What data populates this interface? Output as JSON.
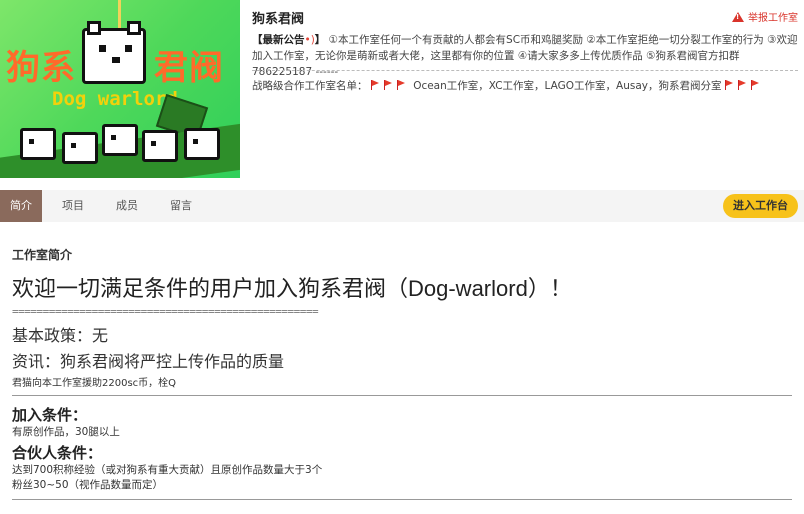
{
  "banner": {
    "cn_left": "狗系",
    "cn_right": "君阀",
    "en_title": "Dog warlord"
  },
  "studio": {
    "name": "狗系君阀",
    "report_label": "举报工作室"
  },
  "announcement": {
    "tag": "【最新公告",
    "tag_end": "】",
    "text": "①本工作室任何一个有贡献的人都会有SC币和鸡腿奖励 ②本工作室拒绝一切分裂工作室的行为 ③欢迎加入工作室，无论你是萌新或者大佬，这里都有你的位置 ④请大家多多上传优质作品 ⑤狗系君阀官方扣群786225187 ------"
  },
  "partners": {
    "label": "战略级合作工作室名单：",
    "list": "Ocean工作室，XC工作室，LAGO工作室，Ausay，狗系君阀分室"
  },
  "tabs": [
    "简介",
    "项目",
    "成员",
    "留言"
  ],
  "enter_button": "进入工作台",
  "intro": {
    "heading": "工作室简介",
    "welcome": "欢迎一切满足条件的用户加入狗系君阀（Dog-warlord）！",
    "equals": "==================================================",
    "policy": "基本政策：无",
    "news": "资讯：狗系君阀将严控上传作品的质量",
    "donate": "君猫向本工作室援助2200sc币，栓Q",
    "join_title": "加入条件：",
    "join_line": "有原创作品，30腿以上",
    "partner_title": "合伙人条件：",
    "partner_line1": "达到700积称经验（或对狗系有重大贡献）且原创作品数量大于3个",
    "partner_line2": "粉丝30~50（视作品数量而定）"
  },
  "colors": {
    "active_tab": "#8a6a5c",
    "enter_button": "#f7c21a",
    "report": "#d9342b",
    "banner_text": "#ff6a2a",
    "banner_en": "#f3d10b",
    "banner_bg": "#4ed85a"
  }
}
